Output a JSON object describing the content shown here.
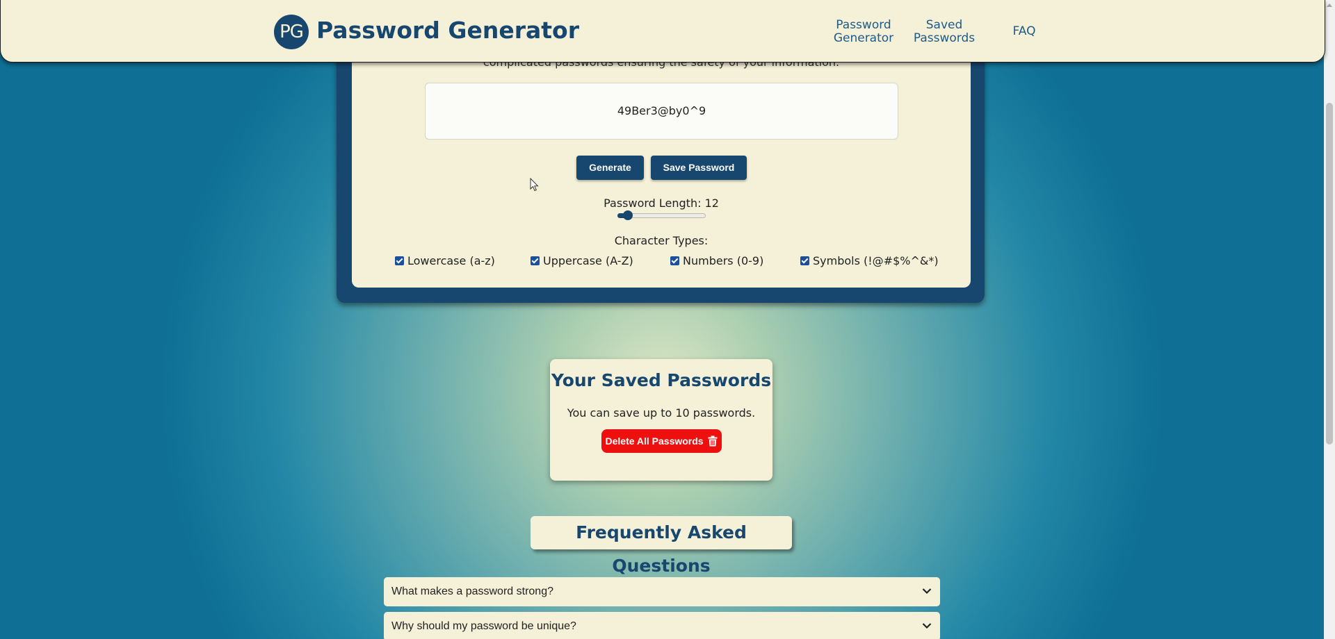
{
  "brand": {
    "logo_text": "PG",
    "title": "Password Generator"
  },
  "nav": {
    "items": [
      {
        "line1": "Password",
        "line2": "Generator"
      },
      {
        "line1": "Saved",
        "line2": "Passwords"
      },
      {
        "line1": "FAQ",
        "line2": ""
      }
    ]
  },
  "generator": {
    "intro_text": "complicated passwords ensuring the safety of your information.",
    "password": "49Ber3@by0^9",
    "generate_label": "Generate",
    "save_label": "Save Password",
    "length_label": "Password Length: 12",
    "length_value": 12,
    "length_fill_fraction": 0.12,
    "char_types_label": "Character Types:",
    "checkboxes": [
      {
        "label": "Lowercase (a-z)",
        "checked": true
      },
      {
        "label": "Uppercase (A-Z)",
        "checked": true
      },
      {
        "label": "Numbers (0-9)",
        "checked": true
      },
      {
        "label": "Symbols (!@#$%^&*)",
        "checked": true
      }
    ]
  },
  "saved": {
    "title": "Your Saved Passwords",
    "subtitle": "You can save up to 10 passwords.",
    "delete_label": "Delete All Passwords"
  },
  "faq": {
    "heading": "Frequently Asked Questions",
    "items": [
      {
        "question": "What makes a password strong?"
      },
      {
        "question": "Why should my password be unique?"
      }
    ]
  },
  "colors": {
    "brand_navy": "#17466f",
    "cream": "#f4f1d8",
    "delete_red": "#ee0f0f",
    "checkbox_blue": "#1a4f9c"
  },
  "icons": {
    "trash": "trash-icon",
    "chevron": "chevron-down-icon",
    "cursor": "mouse-cursor-icon"
  }
}
